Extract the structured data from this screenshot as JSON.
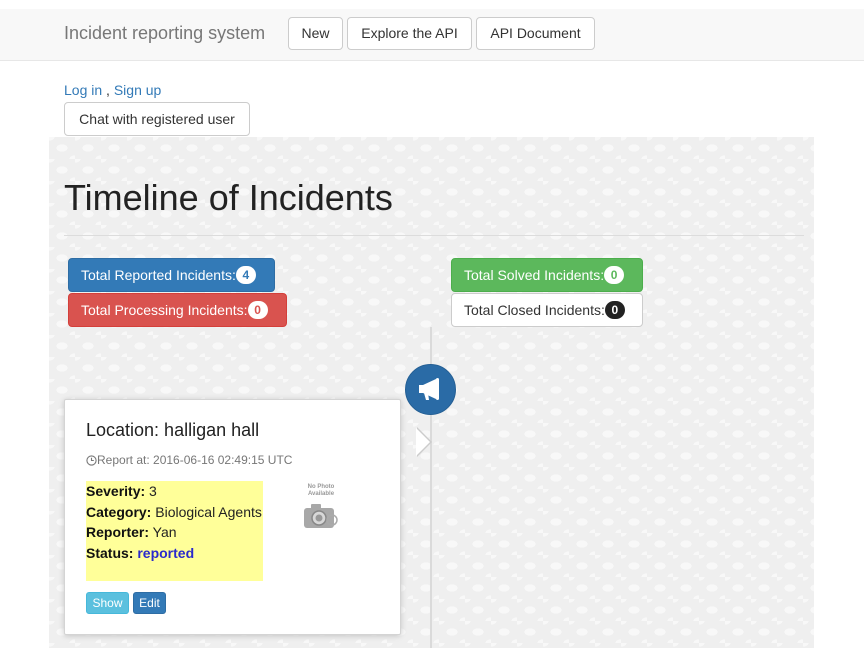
{
  "navbar": {
    "brand": "Incident reporting system",
    "buttons": [
      {
        "label": "New"
      },
      {
        "label": "Explore the API"
      },
      {
        "label": "API Document"
      }
    ]
  },
  "auth": {
    "login": "Log in",
    "separator": ",",
    "signup": "Sign up",
    "chat_button": "Chat with registered user"
  },
  "main": {
    "title": "Timeline of Incidents",
    "stats": [
      {
        "label": "Total Reported Incidents:",
        "count": "4",
        "color": "#337ab7"
      },
      {
        "label": "Total Processing Incidents:",
        "count": "0",
        "color": "#d9534f"
      },
      {
        "label": "Total Solved Incidents:",
        "count": "0",
        "color": "#5cb85c"
      },
      {
        "label": "Total Closed Incidents:",
        "count": "0",
        "color": "#ffffff"
      }
    ],
    "timeline_icon": "megaphone-icon",
    "incident": {
      "location": "Location: halligan hall",
      "report_time": "Report at: 2016-06-16 02:49:15 UTC",
      "clock_icon": "clock-icon",
      "severity_label": "Severity:",
      "severity_value": "3",
      "category_label": "Category:",
      "category_value": "Biological Agents",
      "reporter_label": "Reporter:",
      "reporter_value": "Yan",
      "status_label": "Status:",
      "status_value": "reported",
      "photo_placeholder": "No Photo Available",
      "show_button": "Show",
      "edit_button": "Edit"
    }
  }
}
